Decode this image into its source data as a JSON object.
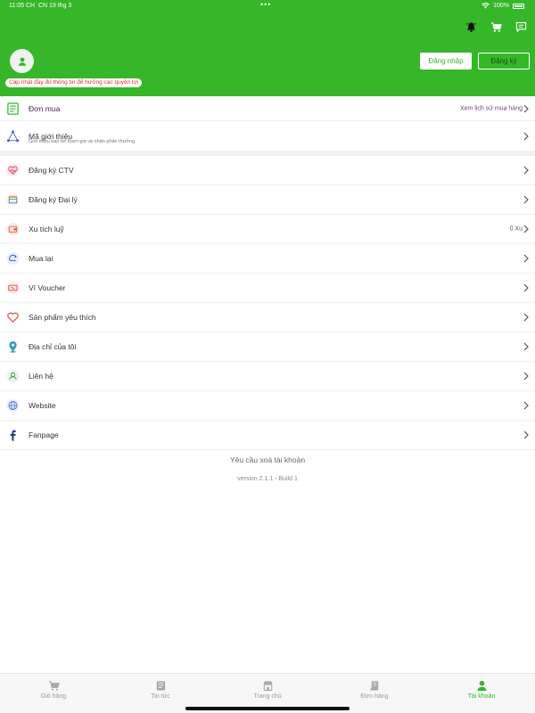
{
  "statusbar": {
    "time": "11:05 CH",
    "date": "CN 19 thg 3",
    "dots": "•••",
    "battery": "100%"
  },
  "header": {
    "profile_note": "Cập nhật đầy đủ thông tin để hưởng các quyền lợi",
    "login_label": "Đăng nhập",
    "register_label": "Đăng ký",
    "bg_color": "#35b729"
  },
  "orders": {
    "label": "Đơn mua",
    "right_text": "Xem lịch sử mua hàng"
  },
  "referral": {
    "label": "Mã giới thiệu",
    "sub": "Giới thiệu bạn bè tham gia và nhận phần thưởng"
  },
  "menu": [
    {
      "label": "Đăng ký CTV",
      "icon": "heart-pulse-icon",
      "right": ""
    },
    {
      "label": "Đăng ký Đại lý",
      "icon": "store-icon",
      "right": ""
    },
    {
      "label": "Xu tích luỹ",
      "icon": "wallet-icon",
      "right": "0 Xu"
    },
    {
      "label": "Mua lại",
      "icon": "recycle-icon",
      "right": ""
    },
    {
      "label": "Ví Voucher",
      "icon": "voucher-icon",
      "right": ""
    },
    {
      "label": "Sản phẩm yêu thích",
      "icon": "heart-icon",
      "right": ""
    },
    {
      "label": "Địa chỉ của tôi",
      "icon": "location-pin-icon",
      "right": ""
    },
    {
      "label": "Liên hệ",
      "icon": "contact-icon",
      "right": ""
    },
    {
      "label": "Website",
      "icon": "globe-icon",
      "right": ""
    },
    {
      "label": "Fanpage",
      "icon": "facebook-icon",
      "right": ""
    }
  ],
  "footer": {
    "delete_account": "Yêu cầu xoá tài khoản",
    "version": "version 2.1.1 - Build 1"
  },
  "tabs": [
    {
      "label": "Giỏ hàng",
      "icon": "cart-icon"
    },
    {
      "label": "Tin tức",
      "icon": "news-icon"
    },
    {
      "label": "Trang chủ",
      "icon": "home-store-icon"
    },
    {
      "label": "Đơn hàng",
      "icon": "orders-icon"
    },
    {
      "label": "Tài khoản",
      "icon": "account-icon",
      "active": true
    }
  ]
}
